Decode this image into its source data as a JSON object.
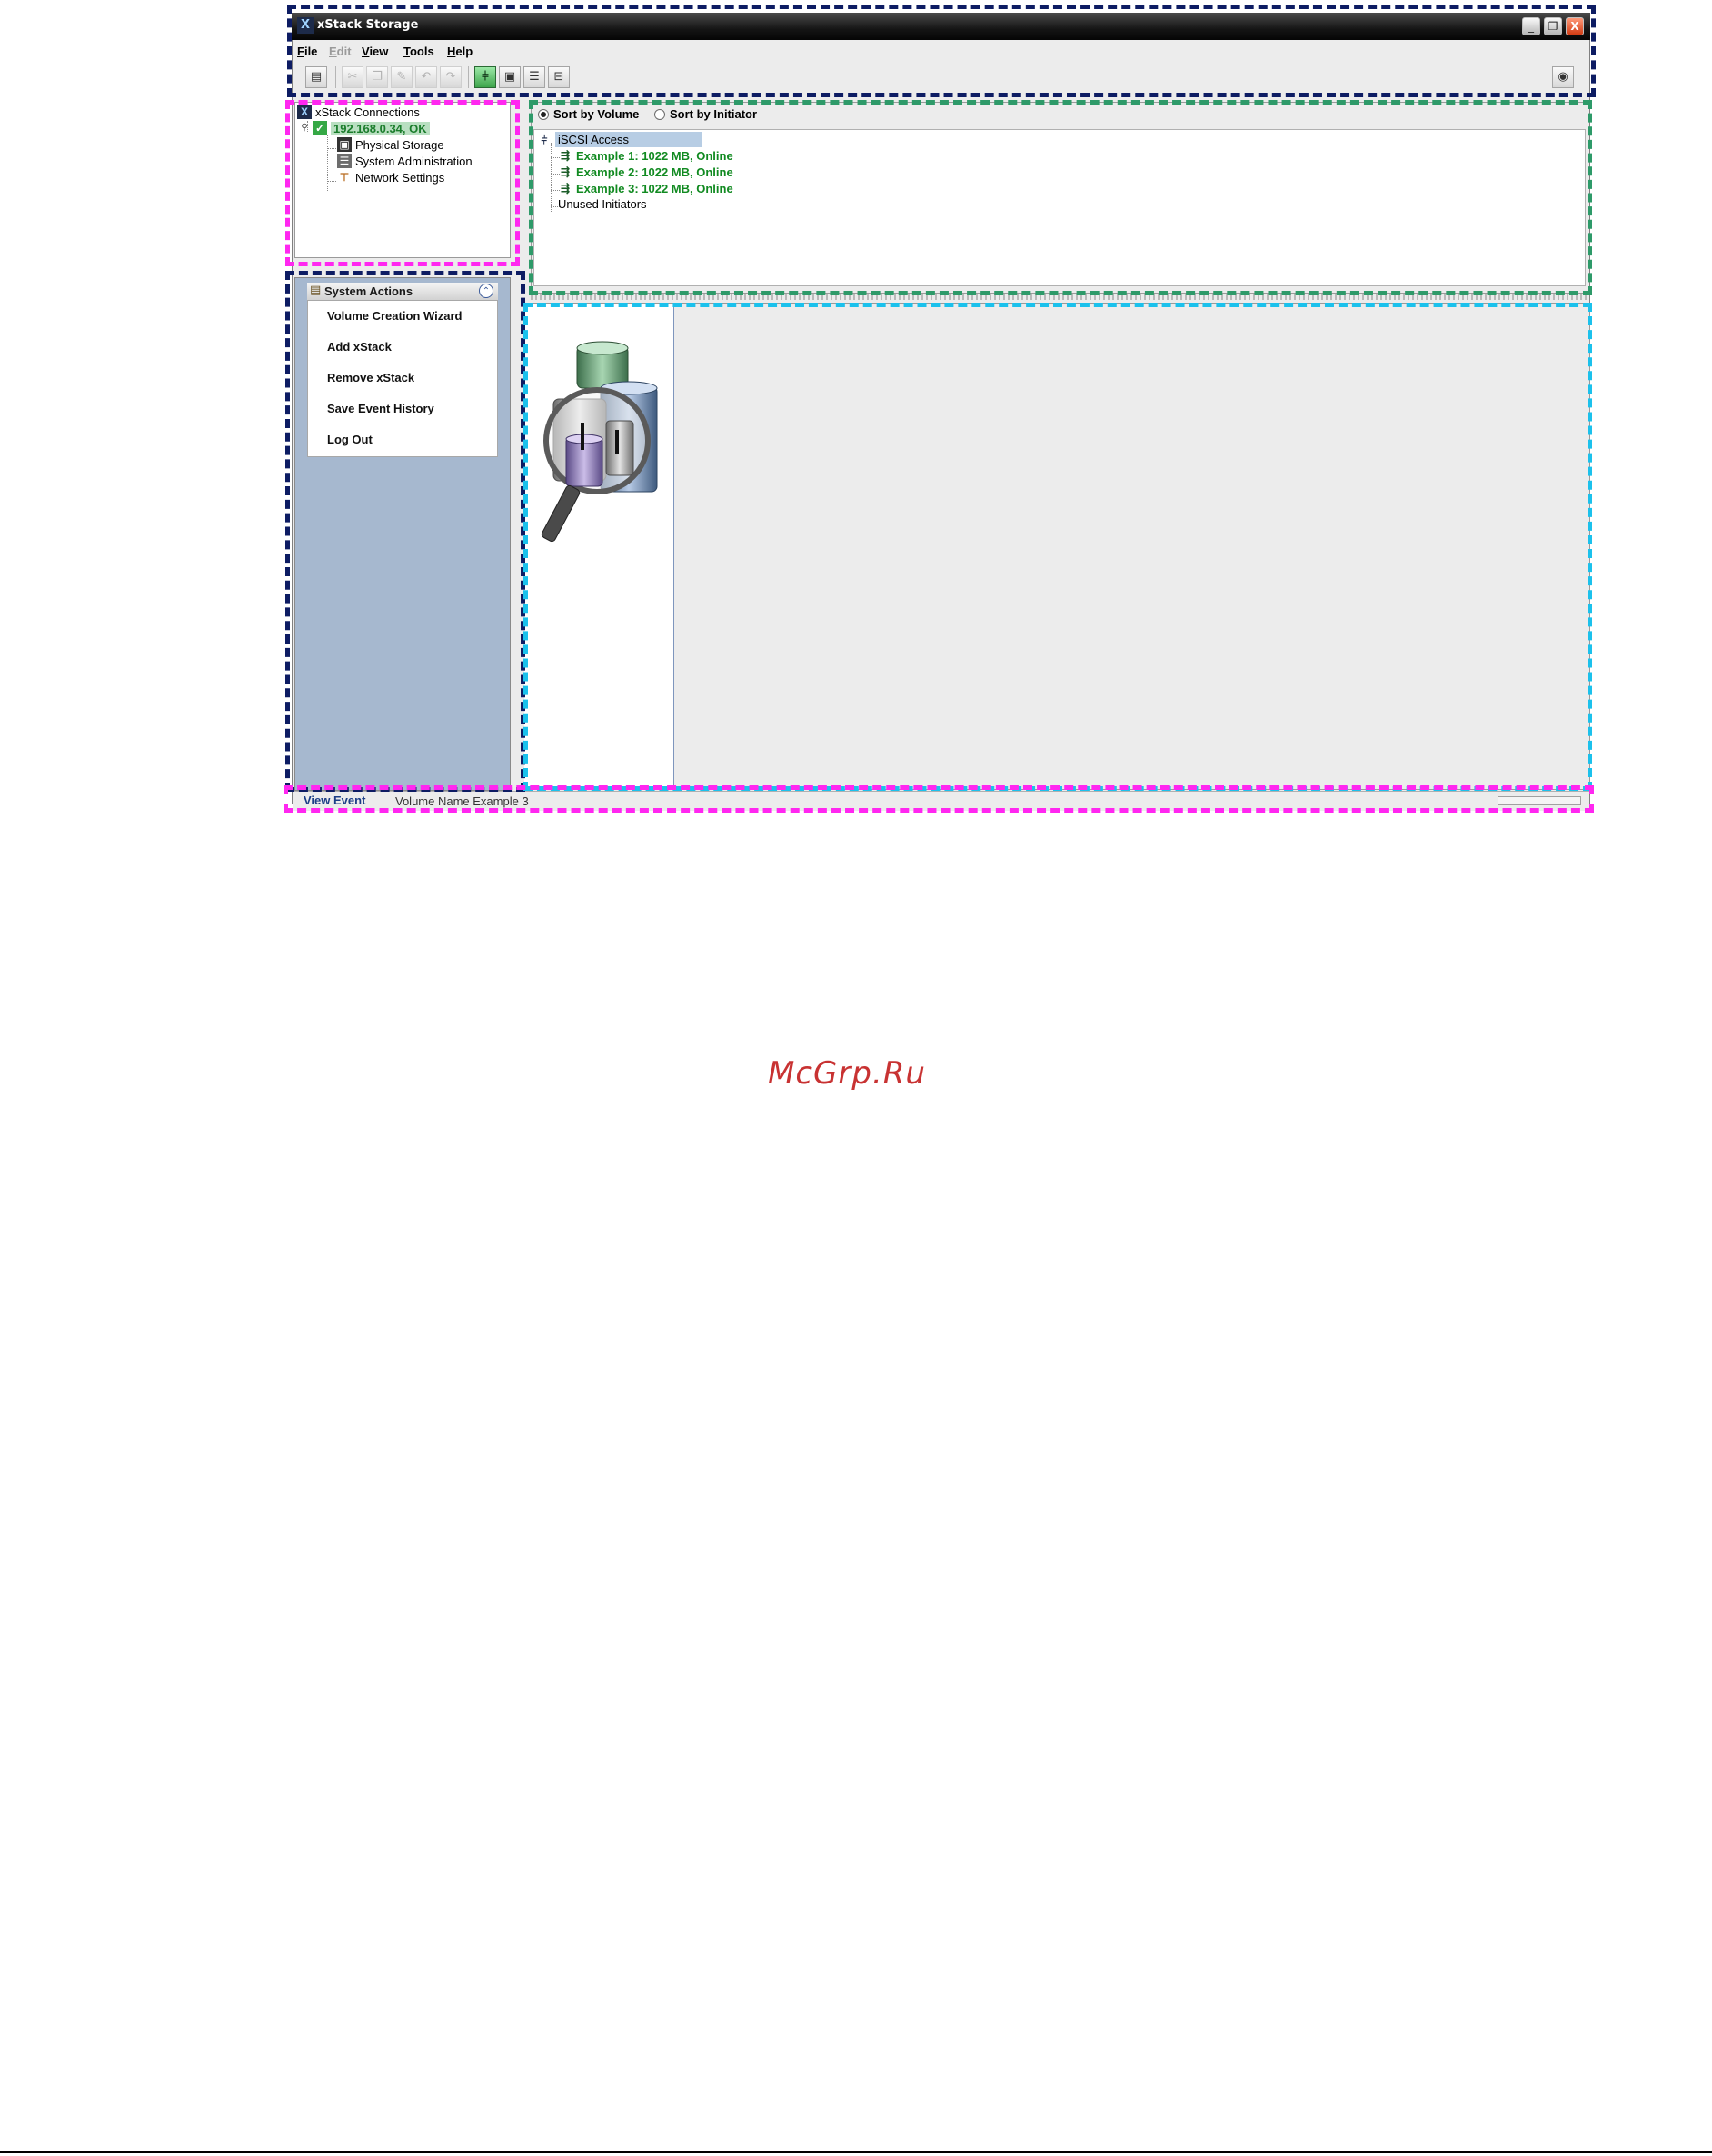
{
  "window": {
    "title": "xStack Storage",
    "title_icon": "X",
    "controls": {
      "minimize": "_",
      "maximize": "❐",
      "close": "X"
    }
  },
  "menu": [
    {
      "label": "File",
      "hotkey": "F",
      "rest": "ile",
      "enabled": true
    },
    {
      "label": "Edit",
      "hotkey": "E",
      "rest": "dit",
      "enabled": false
    },
    {
      "label": "View",
      "hotkey": "V",
      "rest": "iew",
      "enabled": true
    },
    {
      "label": "Tools",
      "hotkey": "T",
      "rest": "ools",
      "enabled": true
    },
    {
      "label": "Help",
      "hotkey": "H",
      "rest": "elp",
      "enabled": true
    }
  ],
  "toolbar": {
    "icons": [
      {
        "name": "properties-icon",
        "glyph": "▤",
        "state": "normal"
      },
      {
        "name": "cut-icon",
        "glyph": "✂",
        "state": "disabled"
      },
      {
        "name": "copy-icon",
        "glyph": "❐",
        "state": "disabled"
      },
      {
        "name": "edit-icon",
        "glyph": "✎",
        "state": "disabled"
      },
      {
        "name": "undo-icon",
        "glyph": "↶",
        "state": "disabled"
      },
      {
        "name": "redo-icon",
        "glyph": "↷",
        "state": "disabled"
      },
      {
        "name": "iscsi-access-icon",
        "glyph": "⫩",
        "state": "active"
      },
      {
        "name": "physical-storage-icon",
        "glyph": "▣",
        "state": "normal"
      },
      {
        "name": "system-admin-icon",
        "glyph": "☰",
        "state": "normal"
      },
      {
        "name": "network-settings-icon",
        "glyph": "⊟",
        "state": "normal"
      },
      {
        "name": "about-icon",
        "glyph": "◉",
        "state": "normal"
      }
    ]
  },
  "connections_tree": {
    "root": "xStack Connections",
    "node": "192.168.0.34, OK",
    "expander": "⚲",
    "children": [
      {
        "label": "Physical Storage",
        "icon": "physical-storage-icon",
        "glyph": "▣"
      },
      {
        "label": "System Administration",
        "icon": "system-admin-icon",
        "glyph": "☰"
      },
      {
        "label": "Network Settings",
        "icon": "network-settings-icon",
        "glyph": "⊤"
      }
    ]
  },
  "system_actions": {
    "title": "System Actions",
    "collapse_glyph": "⌃",
    "items": [
      "Volume Creation Wizard",
      "Add xStack",
      "Remove xStack",
      "Save Event History",
      "Log Out"
    ]
  },
  "iscsi": {
    "sort_by_volume": "Sort by Volume",
    "sort_by_initiator": "Sort by Initiator",
    "selected_sort": "volume",
    "root": "iSCSI Access",
    "volumes": [
      "Example 1: 1022 MB, Online",
      "Example 2: 1022 MB, Online",
      "Example 3: 1022 MB, Online"
    ],
    "unused": "Unused Initiators"
  },
  "status": {
    "tab": "View Event",
    "text": "Volume Name Example 3"
  },
  "watermark": "McGrp.Ru",
  "colors": {
    "frame_navy": "#0d1c63",
    "frame_magenta": "#ff27f0",
    "frame_green": "#2e9a69",
    "frame_cyan": "#1bc1ec",
    "online_green": "#118a21",
    "actions_background": "#a6b8cf"
  }
}
